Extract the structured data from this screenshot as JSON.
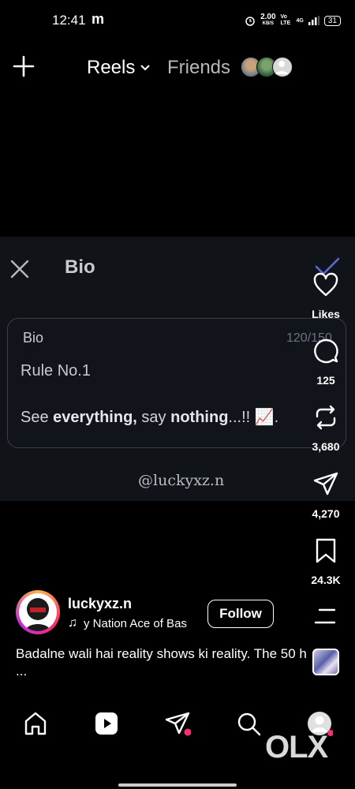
{
  "status_bar": {
    "time": "12:41",
    "carrier_logo": "m",
    "net_speed": "2.00",
    "net_unit": "KB/S",
    "volte": "Vo LTE",
    "signal": "4G",
    "battery": "31",
    "icons": [
      "alarm-icon",
      "signal-icon",
      "battery-icon"
    ]
  },
  "top_bar": {
    "reels_label": "Reels",
    "friends_label": "Friends"
  },
  "bio_editor": {
    "title": "Bio",
    "field_label": "Bio",
    "char_count": "120/150",
    "line1": "Rule No.1",
    "line2_see": "See ",
    "line2_everything": "everything,",
    "line2_say": " say ",
    "line2_nothing": "nothing",
    "line2_end": "...!! 📈."
  },
  "watermark": "@luckyxz.n",
  "rail": {
    "likes": "Likes",
    "comments": "125",
    "reposts": "3,680",
    "shares": "4,270",
    "saves": "24.3K"
  },
  "post": {
    "username": "luckyxz.n",
    "music_text": "y Nation    Ace of Bas",
    "follow_label": "Follow",
    "caption": "Badalne wali hai reality shows ki reality. The 50 h ..."
  },
  "overlay_logo": "OLX",
  "colors": {
    "background": "#000000",
    "video_bg": "#101318",
    "accent_dot": "#ff2d6f",
    "check": "#5b6ad8"
  }
}
